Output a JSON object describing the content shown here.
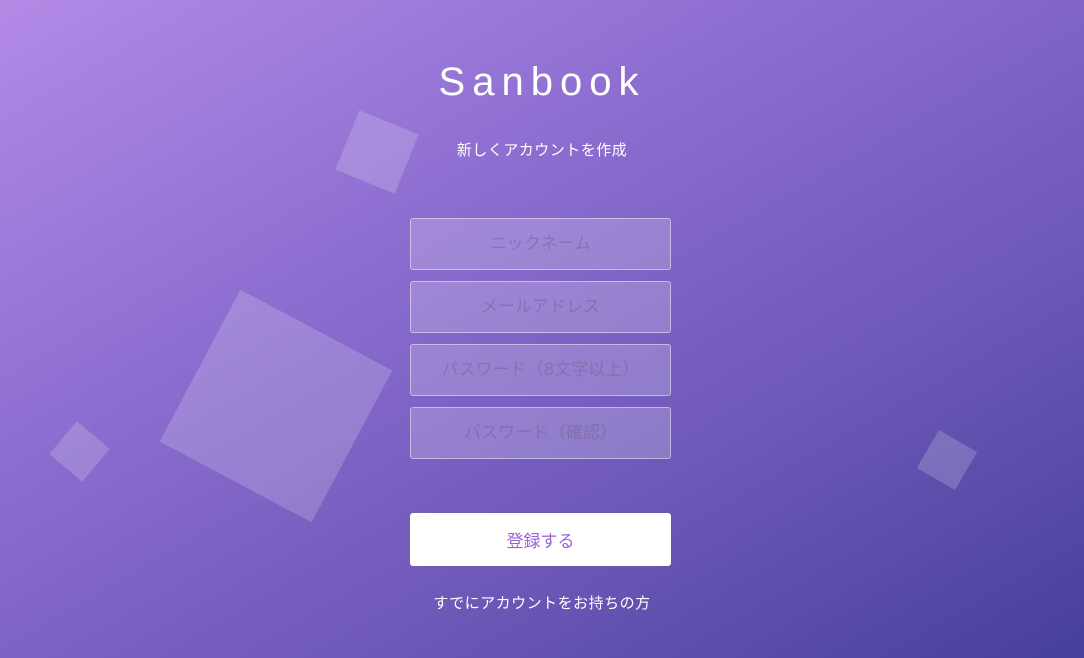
{
  "app": {
    "name": "Sanbook"
  },
  "header": {
    "subtitle": "新しくアカウントを作成"
  },
  "form": {
    "nickname_placeholder": "ニックネーム",
    "email_placeholder": "メールアドレス",
    "password_placeholder": "パスワード（8文字以上）",
    "password_confirm_placeholder": "パスワード（確認）",
    "nickname_value": "",
    "email_value": "",
    "password_value": "",
    "password_confirm_value": ""
  },
  "actions": {
    "register_label": "登録する",
    "login_link_label": "すでにアカウントをお持ちの方"
  },
  "colors": {
    "gradient_start": "#b38ae6",
    "gradient_end": "#46409a",
    "button_text": "#9a63d6",
    "button_bg": "#ffffff"
  }
}
